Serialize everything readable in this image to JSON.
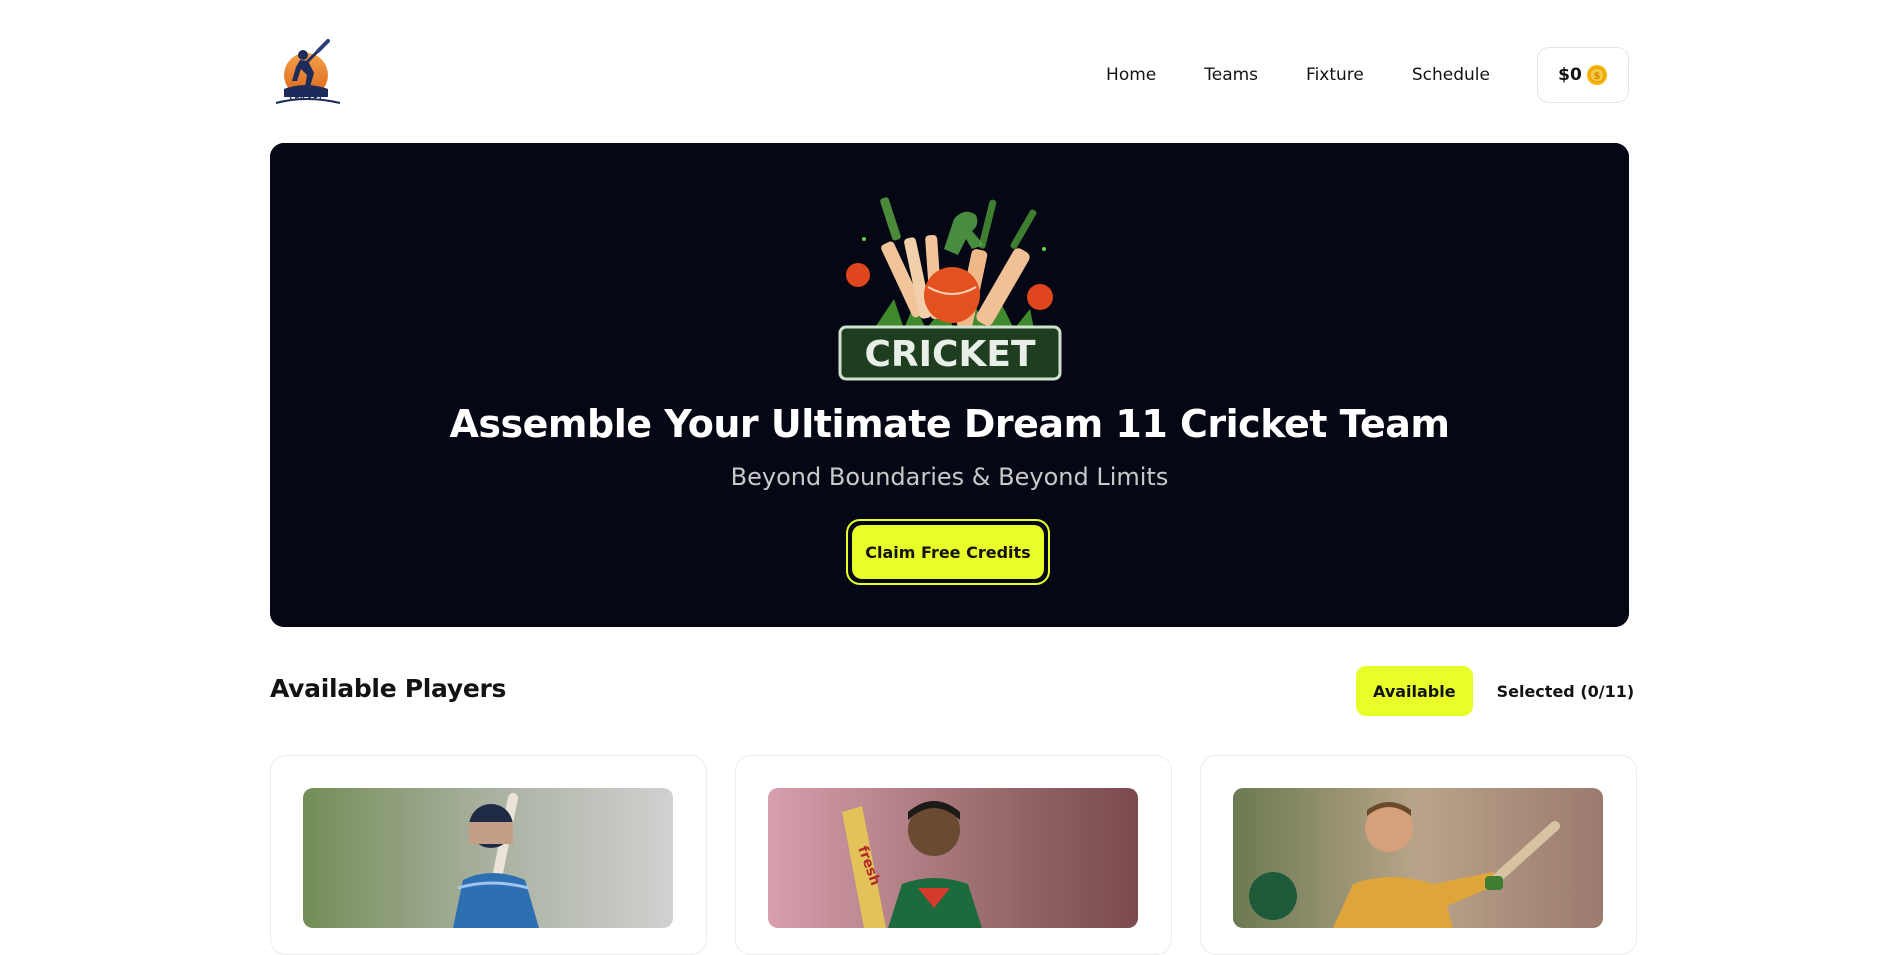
{
  "brand": {
    "logo": "cricket-logo",
    "logo_text": "CRICKET"
  },
  "nav": {
    "items": [
      "Home",
      "Teams",
      "Fixture",
      "Schedule"
    ],
    "coins_label": "$0",
    "coin_icon": "coin-icon"
  },
  "hero": {
    "art_text": "CRICKET",
    "title": "Assemble Your Ultimate Dream 11 Cricket Team",
    "subtitle": "Beyond Boundaries & Beyond Limits",
    "cta": "Claim Free Credits"
  },
  "players_section": {
    "title": "Available Players",
    "tabs": [
      "Available",
      "Selected (0/11)"
    ]
  },
  "colors": {
    "accent": "#e7fe29",
    "hero_bg": "#050814",
    "text": "#131313"
  }
}
